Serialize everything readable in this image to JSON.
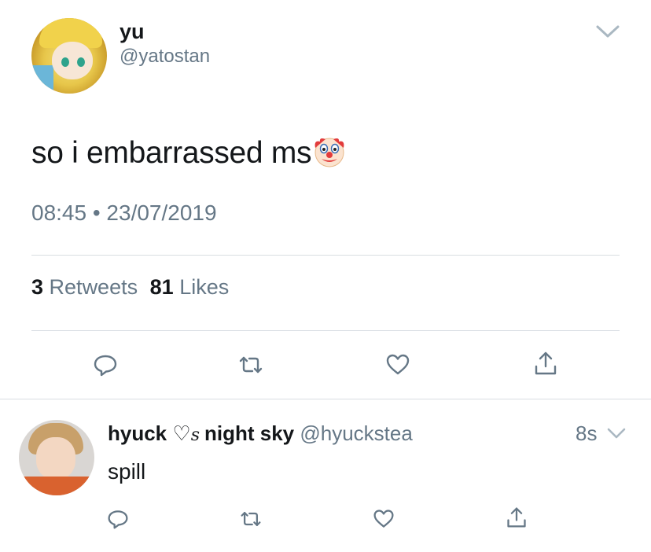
{
  "tweet": {
    "author_name": "yu",
    "author_handle": "@yatostan",
    "text": "so i embarrassed ms",
    "emoji_icon": "clown-face-emoji",
    "timestamp": "08:45 • 23/07/2019",
    "stats": {
      "retweets_count": "3",
      "retweets_label": "Retweets",
      "likes_count": "81",
      "likes_label": "Likes"
    },
    "actions": [
      "reply-icon",
      "retweet-icon",
      "like-icon",
      "share-icon"
    ]
  },
  "reply": {
    "display_name_part1": "hyuck ",
    "display_name_heart": "♡",
    "display_name_suffix": "s",
    "display_name_part2": "night sky",
    "handle": "@hyuckstea",
    "time": "8s",
    "text": "spill",
    "actions": [
      "reply-icon",
      "retweet-icon",
      "like-icon",
      "share-icon"
    ]
  },
  "colors": {
    "primary_text": "#14171a",
    "secondary_text": "#657786",
    "divider": "#d8dde2",
    "background": "#ffffff"
  }
}
